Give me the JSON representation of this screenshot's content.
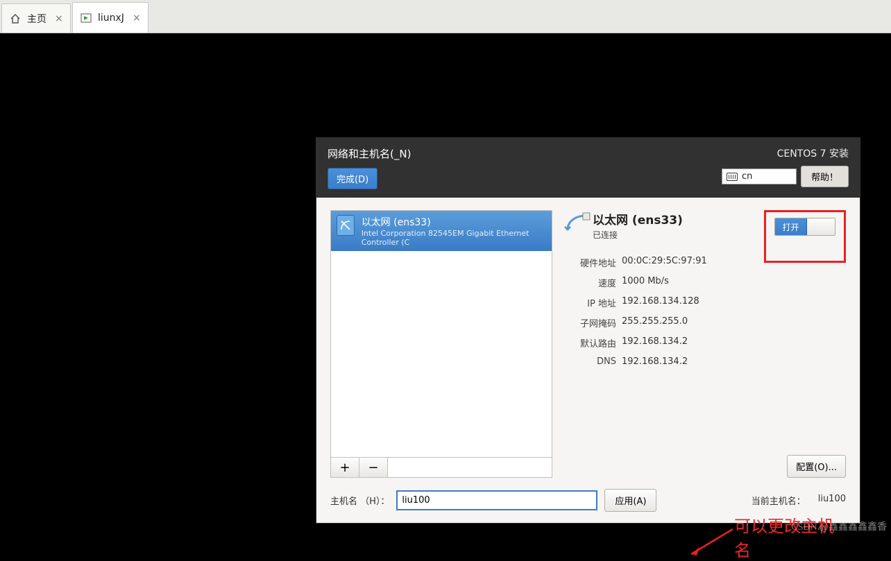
{
  "tabs": {
    "home": "主页",
    "vm": "liunxJ"
  },
  "dialog": {
    "title": "网络和主机名(_N)",
    "done": "完成(D)",
    "install_title": "CENTOS 7 安装",
    "lang": "cn",
    "help": "帮助！"
  },
  "device": {
    "name": "以太网 (ens33)",
    "sub": "Intel Corporation 82545EM Gigabit Ethernet Controller (C"
  },
  "detail": {
    "title": "以太网 (ens33)",
    "status": "已连接",
    "toggle_on": "打开"
  },
  "info": {
    "hw_label": "硬件地址",
    "hw_value": "00:0C:29:5C:97:91",
    "speed_label": "速度",
    "speed_value": "1000 Mb/s",
    "ip_label": "IP 地址",
    "ip_value": "192.168.134.128",
    "mask_label": "子网掩码",
    "mask_value": "255.255.255.0",
    "gw_label": "默认路由",
    "gw_value": "192.168.134.2",
    "dns_label": "DNS",
    "dns_value": "192.168.134.2"
  },
  "buttons": {
    "plus": "+",
    "minus": "−",
    "config": "配置(O)...",
    "apply": "应用(A)"
  },
  "hostname": {
    "label": "主机名 （H）：",
    "value": "liu100",
    "current_label": "当前主机名：",
    "current_value": "liu100"
  },
  "annotation": "可以更改主机名",
  "watermark": "CSDN @鑫鑫鑫鑫鑫香"
}
